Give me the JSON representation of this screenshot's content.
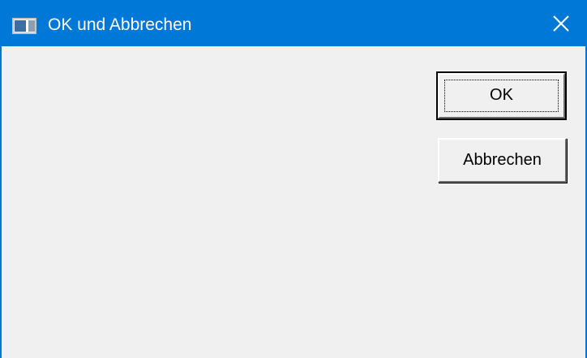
{
  "window": {
    "title": "OK und Abbrechen",
    "titlebar_color": "#0078d7",
    "background_color": "#f0f0f0",
    "icon": "app-window-icon",
    "close_icon": "close-icon"
  },
  "buttons": {
    "ok_label": "OK",
    "cancel_label": "Abbrechen"
  }
}
